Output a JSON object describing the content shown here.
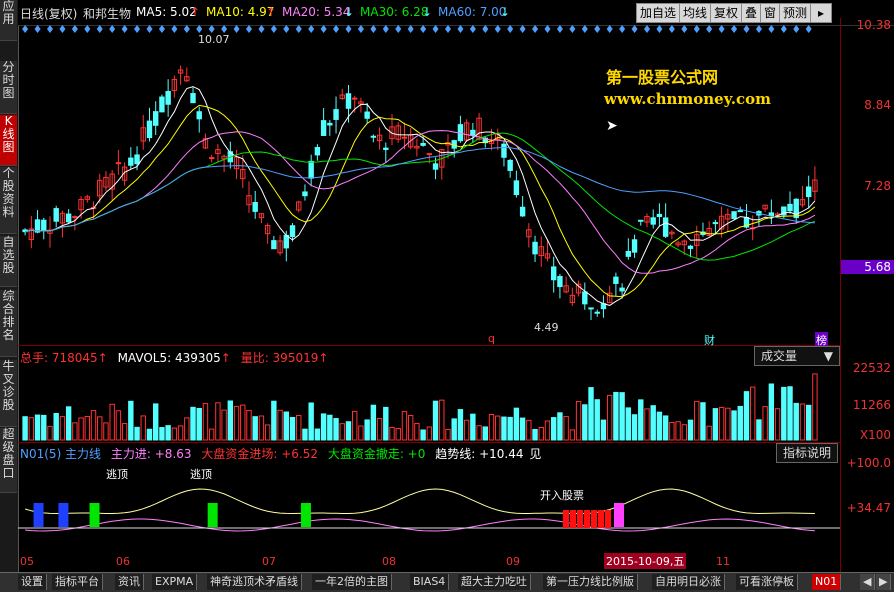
{
  "left_tabs": [
    "应用",
    "分时图",
    "K线图",
    "个股资料",
    "自选股",
    "综合排名",
    "牛叉诊股",
    "超级盘口"
  ],
  "header": {
    "period": "日线(复权)",
    "stock_name": "和邦生物",
    "ma5": "MA5: 5.02",
    "ma10": "MA10: 4.97",
    "ma20": "MA20: 5.34",
    "ma30": "MA30: 6.28",
    "ma60": "MA60: 7.00",
    "buttons": [
      "加自选",
      "均线",
      "复权",
      "叠",
      "窗",
      "预测"
    ],
    "arrow": "▸"
  },
  "watermark": {
    "title": "第一股票公式网",
    "url": "www.chnmoney.com"
  },
  "price_axis": {
    "labels": [
      "10.38",
      "8.84",
      "7.28",
      "5.68"
    ],
    "current": "5.68"
  },
  "annotations": {
    "high": "10.07",
    "low": "4.49",
    "markers": [
      "q",
      "财",
      "榜"
    ]
  },
  "volume_panel": {
    "total": "总手: 718045",
    "mavol": "MAVOL5: 439305",
    "ratio": "量比: 395019",
    "dropdown": "成交量",
    "axis": [
      "22532",
      "11266",
      "X100"
    ]
  },
  "indicator_panel": {
    "name": "N01(5) 主力线",
    "main_in": "主力进: +8.63",
    "capital_in": "大盘资金进场: +6.52",
    "capital_out": "大盘资金撤走: +0",
    "trend": "趋势线: +10.44",
    "see": "见",
    "explain_btn": "指标说明",
    "axis": [
      "+100.0",
      "+34.47"
    ],
    "labels": [
      "逃顶",
      "逃顶",
      "开入股票"
    ]
  },
  "x_axis": {
    "months": [
      "05",
      "06",
      "07",
      "08",
      "09",
      "10",
      "11"
    ],
    "date_label": "2015-10-09,五"
  },
  "bottom_tabs": [
    "设置",
    "指标平台",
    "资讯",
    "EXPMA",
    "神奇逃顶术矛盾线",
    "一年2倍的主图",
    "BIAS4",
    "超大主力吃吐",
    "第一压力线比例版",
    "自用明日必涨",
    "可看涨停板",
    "N01"
  ],
  "colors": {
    "up": "#ff3232",
    "down": "#54ffff",
    "ma5": "#ffffff",
    "ma10": "#ffff00",
    "ma20": "#ff80ff",
    "ma30": "#00e600",
    "ma60": "#4ea0ff"
  },
  "chart_data": {
    "type": "candlestick",
    "series_days": 128,
    "price_high": 10.07,
    "price_low": 4.49,
    "ylim": [
      3.9,
      10.38
    ]
  }
}
